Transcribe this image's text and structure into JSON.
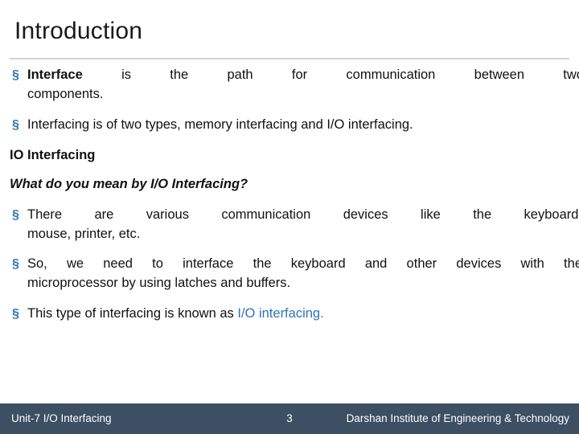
{
  "slide": {
    "title": "Introduction",
    "bullets": {
      "b1_strong": "Interface",
      "b1_rest": "is   the   path   for   communication   between   two",
      "b1_line2": "components.",
      "b2": "Interfacing is of two types, memory interfacing and I/O interfacing.",
      "h1": "IO Interfacing",
      "h2": "What do you mean by I/O Interfacing?",
      "b3_line1": "There  are  various  communication  devices  like  the  keyboard,",
      "b3_line2": "mouse, printer, etc.",
      "b4_line1": "So, we need to interface the keyboard and other devices with the",
      "b4_line2": "microprocessor by using latches and buffers.",
      "b5_pre": "This type of interfacing is known as ",
      "b5_link": "I/O interfacing."
    },
    "bullet_marker": "§"
  },
  "footer": {
    "left": "Unit-7 I/O Interfacing",
    "page": "3",
    "right": "Darshan Institute of Engineering & Technology",
    "bg_color": "#3c4f63"
  },
  "colors": {
    "accent": "#2e74b5",
    "text": "#111111",
    "rule": "#d3d3d3"
  }
}
